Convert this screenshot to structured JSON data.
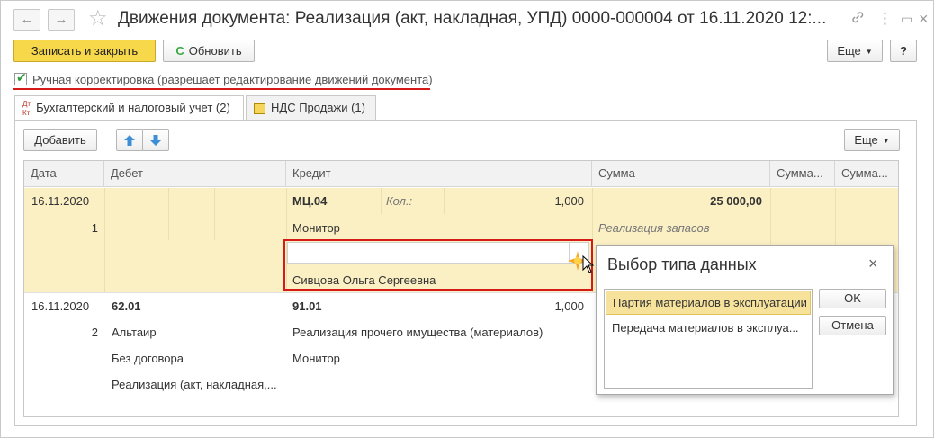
{
  "window": {
    "title": "Движения документа: Реализация (акт, накладная, УПД) 0000-000004 от 16.11.2020 12:...",
    "nav_back": "←",
    "nav_forward": "→",
    "star": "☆",
    "link_icon": "🔗",
    "menu_icon": "⋮",
    "max_icon": "▭",
    "close_icon": "×"
  },
  "toolbar": {
    "save_close_label": "Записать и закрыть",
    "refresh_label": "Обновить",
    "refresh_icon": "C",
    "more_label": "Еще",
    "help_label": "?"
  },
  "manual_adjust": {
    "checked": true,
    "label": "Ручная корректировка (разрешает редактирование движений документа)"
  },
  "tabs": [
    {
      "label": "Бухгалтерский и налоговый учет (2)",
      "icon": "Дт Кт",
      "active": true
    },
    {
      "label": "НДС Продажи (1)",
      "active": false
    }
  ],
  "panel_toolbar": {
    "add_label": "Добавить",
    "up_icon": "🡅",
    "down_icon": "🡇",
    "more_label": "Еще"
  },
  "table": {
    "columns": [
      "Дата",
      "Дебет",
      "Кредит",
      "Сумма",
      "Сумма...",
      "Сумма..."
    ],
    "rows": [
      {
        "date": "16.11.2020",
        "number": "1",
        "credit_account": "МЦ.04",
        "qty_label": "Кол.:",
        "qty": "1,000",
        "amount": "25 000,00",
        "credit_sub1": "Монитор",
        "content": "Реализация запасов",
        "credit_sub3": "Сивцова Ольга Сергеевна"
      },
      {
        "date": "16.11.2020",
        "number": "2",
        "debit_account": "62.01",
        "debit_sub1": "Альтаир",
        "debit_sub2": "Без договора",
        "debit_sub3": "Реализация (акт, накладная,...",
        "credit_account": "91.01",
        "qty": "1,000",
        "credit_sub1": "Реализация прочего имущества (материалов)",
        "credit_sub2": "Монитор"
      }
    ]
  },
  "dialog": {
    "title": "Выбор типа данных",
    "close_icon": "×",
    "options": [
      "Партия материалов в эксплуатации",
      "Передача материалов в эксплуа..."
    ],
    "selected_index": 0,
    "ok_label": "OK",
    "cancel_label": "Отмена"
  },
  "colors": {
    "accent_yellow": "#f7d84a",
    "selected_row": "#fbefc4",
    "highlight_red": "#d51a1a",
    "list_selection": "#f7e29b"
  }
}
